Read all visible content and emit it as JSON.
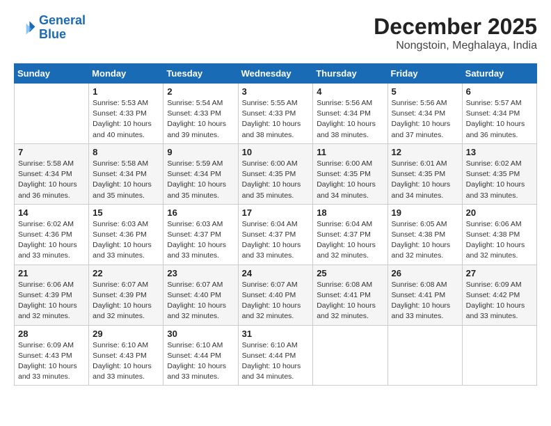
{
  "logo": {
    "line1": "General",
    "line2": "Blue"
  },
  "title": "December 2025",
  "subtitle": "Nongstoin, Meghalaya, India",
  "days_header": [
    "Sunday",
    "Monday",
    "Tuesday",
    "Wednesday",
    "Thursday",
    "Friday",
    "Saturday"
  ],
  "weeks": [
    [
      {
        "date": "",
        "info": ""
      },
      {
        "date": "1",
        "info": "Sunrise: 5:53 AM\nSunset: 4:33 PM\nDaylight: 10 hours\nand 40 minutes."
      },
      {
        "date": "2",
        "info": "Sunrise: 5:54 AM\nSunset: 4:33 PM\nDaylight: 10 hours\nand 39 minutes."
      },
      {
        "date": "3",
        "info": "Sunrise: 5:55 AM\nSunset: 4:33 PM\nDaylight: 10 hours\nand 38 minutes."
      },
      {
        "date": "4",
        "info": "Sunrise: 5:56 AM\nSunset: 4:34 PM\nDaylight: 10 hours\nand 38 minutes."
      },
      {
        "date": "5",
        "info": "Sunrise: 5:56 AM\nSunset: 4:34 PM\nDaylight: 10 hours\nand 37 minutes."
      },
      {
        "date": "6",
        "info": "Sunrise: 5:57 AM\nSunset: 4:34 PM\nDaylight: 10 hours\nand 36 minutes."
      }
    ],
    [
      {
        "date": "7",
        "info": "Sunrise: 5:58 AM\nSunset: 4:34 PM\nDaylight: 10 hours\nand 36 minutes."
      },
      {
        "date": "8",
        "info": "Sunrise: 5:58 AM\nSunset: 4:34 PM\nDaylight: 10 hours\nand 35 minutes."
      },
      {
        "date": "9",
        "info": "Sunrise: 5:59 AM\nSunset: 4:34 PM\nDaylight: 10 hours\nand 35 minutes."
      },
      {
        "date": "10",
        "info": "Sunrise: 6:00 AM\nSunset: 4:35 PM\nDaylight: 10 hours\nand 35 minutes."
      },
      {
        "date": "11",
        "info": "Sunrise: 6:00 AM\nSunset: 4:35 PM\nDaylight: 10 hours\nand 34 minutes."
      },
      {
        "date": "12",
        "info": "Sunrise: 6:01 AM\nSunset: 4:35 PM\nDaylight: 10 hours\nand 34 minutes."
      },
      {
        "date": "13",
        "info": "Sunrise: 6:02 AM\nSunset: 4:35 PM\nDaylight: 10 hours\nand 33 minutes."
      }
    ],
    [
      {
        "date": "14",
        "info": "Sunrise: 6:02 AM\nSunset: 4:36 PM\nDaylight: 10 hours\nand 33 minutes."
      },
      {
        "date": "15",
        "info": "Sunrise: 6:03 AM\nSunset: 4:36 PM\nDaylight: 10 hours\nand 33 minutes."
      },
      {
        "date": "16",
        "info": "Sunrise: 6:03 AM\nSunset: 4:37 PM\nDaylight: 10 hours\nand 33 minutes."
      },
      {
        "date": "17",
        "info": "Sunrise: 6:04 AM\nSunset: 4:37 PM\nDaylight: 10 hours\nand 33 minutes."
      },
      {
        "date": "18",
        "info": "Sunrise: 6:04 AM\nSunset: 4:37 PM\nDaylight: 10 hours\nand 32 minutes."
      },
      {
        "date": "19",
        "info": "Sunrise: 6:05 AM\nSunset: 4:38 PM\nDaylight: 10 hours\nand 32 minutes."
      },
      {
        "date": "20",
        "info": "Sunrise: 6:06 AM\nSunset: 4:38 PM\nDaylight: 10 hours\nand 32 minutes."
      }
    ],
    [
      {
        "date": "21",
        "info": "Sunrise: 6:06 AM\nSunset: 4:39 PM\nDaylight: 10 hours\nand 32 minutes."
      },
      {
        "date": "22",
        "info": "Sunrise: 6:07 AM\nSunset: 4:39 PM\nDaylight: 10 hours\nand 32 minutes."
      },
      {
        "date": "23",
        "info": "Sunrise: 6:07 AM\nSunset: 4:40 PM\nDaylight: 10 hours\nand 32 minutes."
      },
      {
        "date": "24",
        "info": "Sunrise: 6:07 AM\nSunset: 4:40 PM\nDaylight: 10 hours\nand 32 minutes."
      },
      {
        "date": "25",
        "info": "Sunrise: 6:08 AM\nSunset: 4:41 PM\nDaylight: 10 hours\nand 32 minutes."
      },
      {
        "date": "26",
        "info": "Sunrise: 6:08 AM\nSunset: 4:41 PM\nDaylight: 10 hours\nand 33 minutes."
      },
      {
        "date": "27",
        "info": "Sunrise: 6:09 AM\nSunset: 4:42 PM\nDaylight: 10 hours\nand 33 minutes."
      }
    ],
    [
      {
        "date": "28",
        "info": "Sunrise: 6:09 AM\nSunset: 4:43 PM\nDaylight: 10 hours\nand 33 minutes."
      },
      {
        "date": "29",
        "info": "Sunrise: 6:10 AM\nSunset: 4:43 PM\nDaylight: 10 hours\nand 33 minutes."
      },
      {
        "date": "30",
        "info": "Sunrise: 6:10 AM\nSunset: 4:44 PM\nDaylight: 10 hours\nand 33 minutes."
      },
      {
        "date": "31",
        "info": "Sunrise: 6:10 AM\nSunset: 4:44 PM\nDaylight: 10 hours\nand 34 minutes."
      },
      {
        "date": "",
        "info": ""
      },
      {
        "date": "",
        "info": ""
      },
      {
        "date": "",
        "info": ""
      }
    ]
  ]
}
